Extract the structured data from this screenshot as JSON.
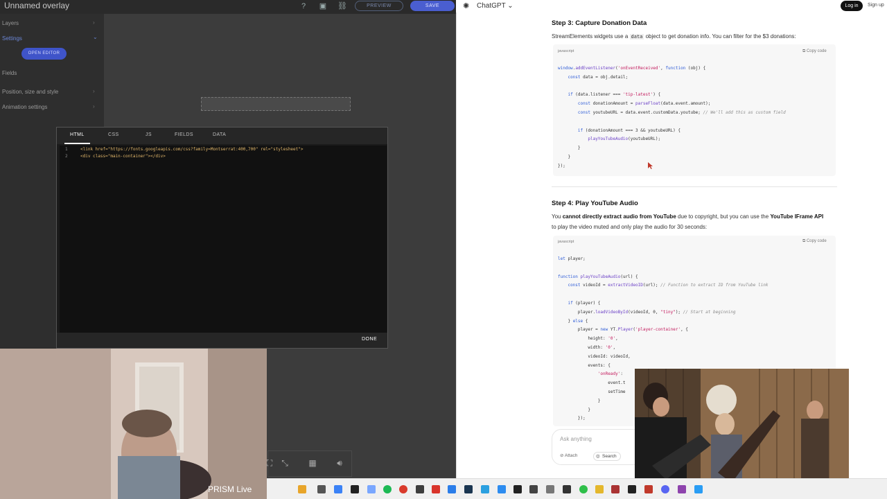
{
  "se": {
    "title": "Unnamed overlay",
    "preview_label": "PREVIEW",
    "save_label": "SAVE",
    "sidebar": {
      "layers": "Layers",
      "settings": "Settings",
      "open_editor": "OPEN EDITOR",
      "fields": "Fields",
      "position": "Position, size and style",
      "animation": "Animation settings"
    },
    "modal": {
      "tabs": [
        "HTML",
        "CSS",
        "JS",
        "FIELDS",
        "DATA"
      ],
      "lines": [
        {
          "n": "1",
          "code": "<link href=\"https://fonts.googleapis.com/css?family=Montserrat:400,700\" rel=\"stylesheet\">"
        },
        {
          "n": "2",
          "code": "<div class=\"main-container\"></div>"
        }
      ],
      "done": "DONE"
    },
    "prism": "PRISM Live"
  },
  "gpt": {
    "name": "ChatGPT",
    "login": "Log in",
    "signup": "Sign up",
    "step3_title": "Step 3: Capture Donation Data",
    "step3_p_pre": "StreamElements widgets use a",
    "step3_p_code": "data",
    "step3_p_post": "object to get donation info. You can filter for the $3 donations:",
    "lang": "javascript",
    "copy": "Copy code",
    "step4_title": "Step 4: Play YouTube Audio",
    "step4_p1_pre": "You",
    "step4_p1_bold": "cannot directly extract audio from YouTube",
    "step4_p1_mid": "due to copyright, but you can use the",
    "step4_p1_bold2": "YouTube IFrame API",
    "step4_p2": "to play the video muted and only play the audio for 30 seconds:",
    "ask_placeholder": "Ask anything",
    "attach": "Attach",
    "search": "Search"
  },
  "code3": [
    "window.addEventListener('onEventReceived', function (obj) {",
    "    const data = obj.detail;",
    "",
    "    if (data.listener === 'tip-latest') {",
    "        const donationAmount = parseFloat(data.event.amount);",
    "        const youtubeURL = data.event.customData.youtube; // We'll add this as custom field",
    "",
    "        if (donationAmount === 3 && youtubeURL) {",
    "            playYouTubeAudio(youtubeURL);",
    "        }",
    "    }",
    "});"
  ],
  "code4": [
    "let player;",
    "",
    "function playYouTubeAudio(url) {",
    "    const videoId = extractVideoID(url); // Function to extract ID from YouTube link",
    "",
    "    if (player) {",
    "        player.loadVideoById(videoId, 0, \"tiny\"); // Start at beginning",
    "    } else {",
    "        player = new YT.Player('player-container', {",
    "            height: '0',",
    "            width: '0',",
    "            videoId: videoId,",
    "            events: {",
    "                'onReady':",
    "                    event.t",
    "                    setTime",
    "                }",
    "            }",
    "        });"
  ]
}
